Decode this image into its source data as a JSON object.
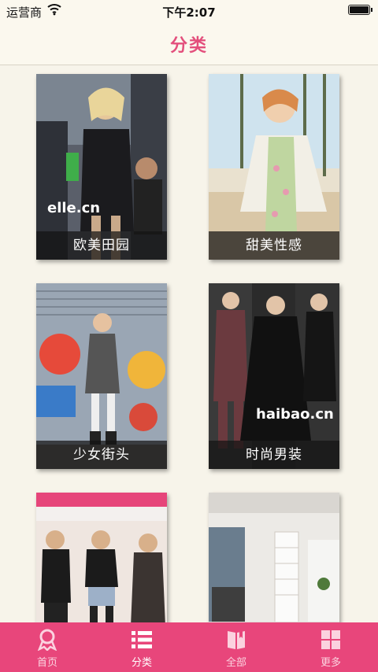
{
  "status_bar": {
    "carrier": "运营商",
    "time": "下午2:07"
  },
  "nav": {
    "title": "分类"
  },
  "categories": [
    {
      "label": "欧美田园",
      "watermark": "elle.cn"
    },
    {
      "label": "甜美性感"
    },
    {
      "label": "少女街头"
    },
    {
      "label": "时尚男装",
      "watermark": "haibao.cn"
    },
    {
      "label": ""
    },
    {
      "label": ""
    }
  ],
  "tabbar": {
    "items": [
      {
        "label": "首页",
        "icon": "ribbon-icon"
      },
      {
        "label": "分类",
        "icon": "list-icon",
        "active": true
      },
      {
        "label": "全部",
        "icon": "book-icon"
      },
      {
        "label": "更多",
        "icon": "grid-icon"
      }
    ]
  },
  "colors": {
    "accent": "#e8467b",
    "title": "#e34f7c",
    "background": "#f7f4ea"
  }
}
